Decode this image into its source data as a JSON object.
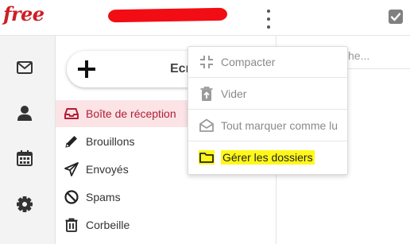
{
  "brand": {
    "logo_text": "free"
  },
  "header": {
    "more_menu_icon": "vertical-dots-icon",
    "select_all_icon": "checkbox-icon"
  },
  "rail": {
    "items": [
      {
        "icon": "envelope-icon"
      },
      {
        "icon": "contacts-icon"
      },
      {
        "icon": "calendar-icon"
      },
      {
        "icon": "gear-icon"
      }
    ]
  },
  "compose": {
    "label": "Ecrire"
  },
  "folders": [
    {
      "label": "Boîte de réception",
      "icon": "inbox-icon",
      "active": true
    },
    {
      "label": "Brouillons",
      "icon": "pencil-icon"
    },
    {
      "label": "Envoyés",
      "icon": "send-icon"
    },
    {
      "label": "Spams",
      "icon": "block-icon"
    },
    {
      "label": "Corbeille",
      "icon": "trash-icon"
    }
  ],
  "search": {
    "placeholder_visible": "he..."
  },
  "menu": {
    "items": [
      {
        "label": "Compacter",
        "icon": "compress-icon",
        "enabled": false
      },
      {
        "label": "Vider",
        "icon": "empty-trash-icon",
        "enabled": false
      },
      {
        "label": "Tout marquer comme lu",
        "icon": "open-envelope-icon",
        "enabled": false
      },
      {
        "label": "Gérer les dossiers",
        "icon": "folder-icon",
        "enabled": true,
        "highlighted": true
      }
    ]
  },
  "colors": {
    "brand_red": "#cd1e25",
    "active_bg": "#fbe3e6",
    "active_text": "#b01e35",
    "highlight": "#fff71a"
  }
}
